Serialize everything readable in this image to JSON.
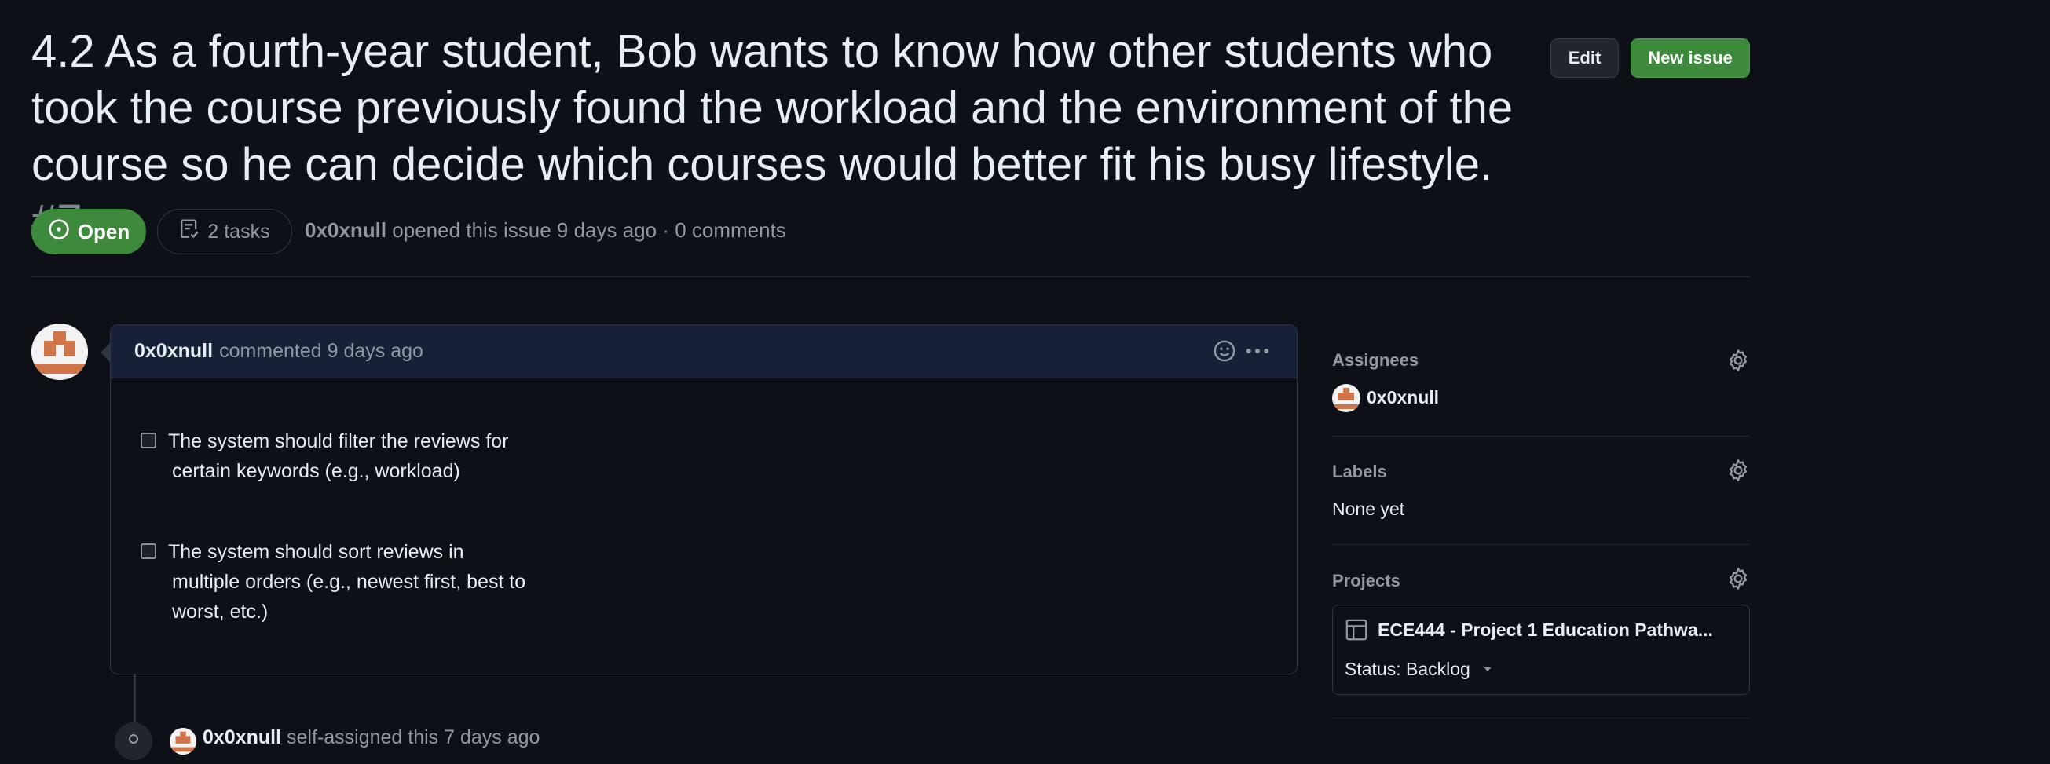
{
  "issue": {
    "title": "4.2 As a fourth-year student, Bob wants to know how other students who took the course previously found the workload and the environment of the course so he can decide which courses would better fit his busy lifestyle.",
    "number": "#7",
    "state": "Open",
    "tasks_label": "2 tasks",
    "author": "0x0xnull",
    "opened_text": "opened this issue 9 days ago · 0 comments"
  },
  "header_buttons": {
    "edit": "Edit",
    "new_issue": "New issue"
  },
  "comment": {
    "author": "0x0xnull",
    "meta": "commented 9 days ago",
    "tasks": [
      {
        "line1": "The system should filter the reviews for",
        "rest": [
          "certain keywords (e.g., workload)"
        ],
        "checked": false
      },
      {
        "line1": "The system should sort reviews in",
        "rest": [
          "multiple orders (e.g., newest first, best to",
          "worst, etc.)"
        ],
        "checked": false
      }
    ]
  },
  "timeline": {
    "author": "0x0xnull",
    "event": "self-assigned this 7 days ago"
  },
  "sidebar": {
    "assignees": {
      "heading": "Assignees",
      "user": "0x0xnull"
    },
    "labels": {
      "heading": "Labels",
      "value": "None yet"
    },
    "projects": {
      "heading": "Projects",
      "project_name": "ECE444 - Project 1 Education Pathwa...",
      "status": "Status: Backlog"
    }
  },
  "colors": {
    "background": "#0d1117",
    "open_green": "#3d8a3c",
    "avatar_orange": "#d0744a"
  },
  "icons": [
    "issue-opened-icon",
    "tasklist-icon",
    "smiley-icon",
    "kebab-horizontal-icon",
    "gear-icon",
    "table-icon",
    "triangle-down-icon",
    "person-icon"
  ]
}
